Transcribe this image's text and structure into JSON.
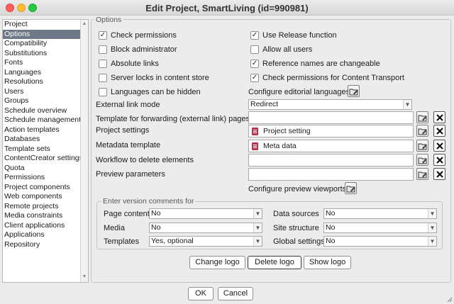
{
  "window": {
    "title": "Edit Project, SmartLiving (id=990981)"
  },
  "sidebar": {
    "items": [
      {
        "label": "Project",
        "selected": false
      },
      {
        "label": "Options",
        "selected": true
      },
      {
        "label": "Compatibility",
        "selected": false
      },
      {
        "label": "Substitutions",
        "selected": false
      },
      {
        "label": "Fonts",
        "selected": false
      },
      {
        "label": "Languages",
        "selected": false
      },
      {
        "label": "Resolutions",
        "selected": false
      },
      {
        "label": "Users",
        "selected": false
      },
      {
        "label": "Groups",
        "selected": false
      },
      {
        "label": "Schedule overview",
        "selected": false
      },
      {
        "label": "Schedule management",
        "selected": false
      },
      {
        "label": "Action templates",
        "selected": false
      },
      {
        "label": "Databases",
        "selected": false
      },
      {
        "label": "Template sets",
        "selected": false
      },
      {
        "label": "ContentCreator settings",
        "selected": false
      },
      {
        "label": "Quota",
        "selected": false
      },
      {
        "label": "Permissions",
        "selected": false
      },
      {
        "label": "Project components",
        "selected": false
      },
      {
        "label": "Web components",
        "selected": false
      },
      {
        "label": "Remote projects",
        "selected": false
      },
      {
        "label": "Media constraints",
        "selected": false
      },
      {
        "label": "Client applications",
        "selected": false
      },
      {
        "label": "Applications",
        "selected": false
      },
      {
        "label": "Repository",
        "selected": false
      }
    ]
  },
  "options": {
    "group_label": "Options",
    "left_checks": [
      {
        "label": "Check permissions",
        "checked": true
      },
      {
        "label": "Block administrator",
        "checked": false
      },
      {
        "label": "Absolute links",
        "checked": false
      },
      {
        "label": "Server locks in content store",
        "checked": false
      },
      {
        "label": "Languages can be hidden",
        "checked": false
      }
    ],
    "right_checks": [
      {
        "label": "Use Release function",
        "checked": true
      },
      {
        "label": "Allow all users",
        "checked": false
      },
      {
        "label": "Reference names are changeable",
        "checked": true
      },
      {
        "label": "Check permissions for Content Transport",
        "checked": true
      }
    ],
    "configure_languages_label": "Configure editorial languages",
    "external_link_mode_label": "External link mode",
    "external_link_mode_value": "Redirect",
    "template_forwarding_label": "Template for forwarding (external link) pages",
    "template_forwarding_value": "",
    "project_settings_label": "Project settings",
    "project_settings_value": "Project setting",
    "metadata_template_label": "Metadata template",
    "metadata_template_value": "Meta data",
    "workflow_delete_label": "Workflow to delete elements",
    "workflow_delete_value": "",
    "preview_params_label": "Preview parameters",
    "preview_params_value": "",
    "configure_viewports_label": "Configure preview viewports"
  },
  "version_comments": {
    "group_label": "Enter version comments for",
    "items": [
      {
        "label": "Page content",
        "value": "No"
      },
      {
        "label": "Media",
        "value": "No"
      },
      {
        "label": "Templates",
        "value": "Yes, optional"
      },
      {
        "label": "Data sources",
        "value": "No"
      },
      {
        "label": "Site structure",
        "value": "No"
      },
      {
        "label": "Global settings",
        "value": "No"
      }
    ]
  },
  "logo_buttons": {
    "change": "Change logo",
    "delete": "Delete logo",
    "show": "Show logo"
  },
  "dialog_buttons": {
    "ok": "OK",
    "cancel": "Cancel"
  }
}
